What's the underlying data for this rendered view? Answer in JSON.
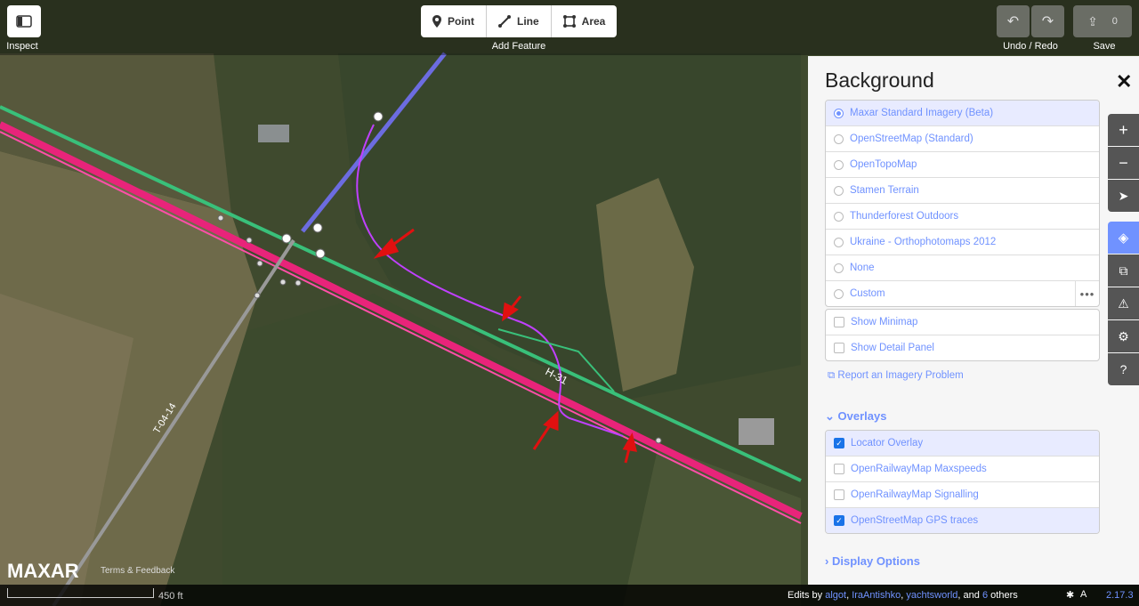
{
  "toolbar": {
    "inspect_label": "Inspect",
    "add_feature_label": "Add Feature",
    "point_label": "Point",
    "line_label": "Line",
    "area_label": "Area",
    "undo_redo_label": "Undo / Redo",
    "save_label": "Save",
    "save_count": "0"
  },
  "map": {
    "road_label_main": "H-31",
    "road_label_side": "T-04-14",
    "attribution_brand": "MAXAR",
    "attribution_link": "Terms & Feedback",
    "scale_label": "450 ft"
  },
  "pane": {
    "title": "Background",
    "imagery": [
      {
        "label": "Maxar Standard Imagery (Beta)",
        "selected": true
      },
      {
        "label": "OpenStreetMap (Standard)",
        "selected": false
      },
      {
        "label": "OpenTopoMap",
        "selected": false
      },
      {
        "label": "Stamen Terrain",
        "selected": false
      },
      {
        "label": "Thunderforest Outdoors",
        "selected": false
      },
      {
        "label": "Ukraine - Orthophotomaps 2012",
        "selected": false
      },
      {
        "label": "None",
        "selected": false
      },
      {
        "label": "Custom",
        "selected": false
      }
    ],
    "show_minimap": "Show Minimap",
    "show_detail_panel": "Show Detail Panel",
    "report_problem": "Report an Imagery Problem",
    "overlays_title": "Overlays",
    "overlays": [
      {
        "label": "Locator Overlay",
        "checked": true
      },
      {
        "label": "OpenRailwayMap Maxspeeds",
        "checked": false
      },
      {
        "label": "OpenRailwayMap Signalling",
        "checked": false
      },
      {
        "label": "OpenStreetMap GPS traces",
        "checked": true
      }
    ],
    "display_options_title": "Display Options"
  },
  "footer": {
    "edits_prefix": "Edits by",
    "user1": "algot",
    "user2": "IraAntishko",
    "user3": "yachtsworld",
    "and": "and",
    "others_count": "6",
    "others_suffix": "others",
    "version": "2.17.3"
  },
  "colors": {
    "accent": "#7092ff",
    "road_pink": "#e8247a",
    "road_green": "#39c07a",
    "gps_magenta": "#c040ff",
    "arrow_red": "#e01010"
  }
}
